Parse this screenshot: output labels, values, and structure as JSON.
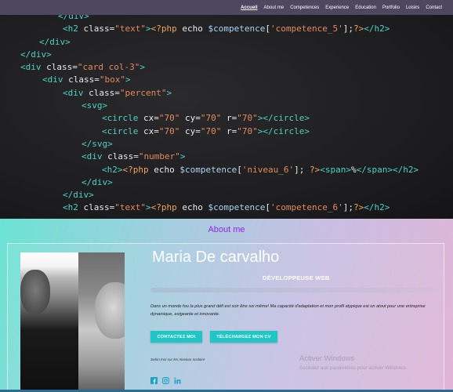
{
  "nav": {
    "items": [
      {
        "label": "Accueil",
        "active": true
      },
      {
        "label": "About me",
        "active": false
      },
      {
        "label": "Competences",
        "active": false
      },
      {
        "label": "Experience",
        "active": false
      },
      {
        "label": "Education",
        "active": false
      },
      {
        "label": "Portfolio",
        "active": false
      },
      {
        "label": "Loisirs",
        "active": false
      },
      {
        "label": "Contact",
        "active": false
      }
    ]
  },
  "hero_code": {
    "lines": [
      [
        "</div>"
      ],
      [
        "<h2 class=\"text\"><?php echo $competence['competence_5'];?></h2>"
      ],
      [
        "</div>"
      ],
      [
        "</div>"
      ],
      [
        "<div class=\"card col-3\">"
      ],
      [
        "<div class=\"box\">"
      ],
      [
        "<div class=\"percent\">"
      ],
      [
        "<svg>"
      ],
      [
        "<circle cx=\"70\" cy=\"70\" r=\"70\"></circle>"
      ],
      [
        "<circle cx=\"70\" cy=\"70\" r=\"70\"></circle>"
      ],
      [
        "</svg>"
      ],
      [
        "<div class=\"number\">"
      ],
      [
        "<h2><?php echo $competence['niveau_6']; ?><span>%</span></h2>"
      ],
      [
        "</div>"
      ],
      [
        "</div>"
      ],
      [
        "<h2 class=\"text\"><?php echo $competence['competence_6'];?></h2>"
      ]
    ]
  },
  "about": {
    "section_title": "About me",
    "name": "Maria De carvalho",
    "role": "DÉVELOPPEUSE WEB",
    "description": "Dans un monde fou la plus grand défi est soir être soi même! Ma capacité d'adaptation et mon profil atypique est un atout pour une entreprise dynamique, exigeante et innovante.",
    "buttons": {
      "contact": "CONTACTEZ MOI",
      "cv": "TÉLÉCHARGEZ MON CV"
    },
    "levels_note": "Selon moi sur les niveaux scolaire",
    "socials": [
      "facebook-icon",
      "instagram-icon",
      "linkedin-icon"
    ]
  },
  "watermark": {
    "title": "Activer Windows",
    "subtitle": "Accédez aux paramètres pour activer Windows."
  },
  "colors": {
    "nav_bg": "#4f4660",
    "accent_button": "#20c6c6",
    "about_title": "#8a2be2"
  }
}
